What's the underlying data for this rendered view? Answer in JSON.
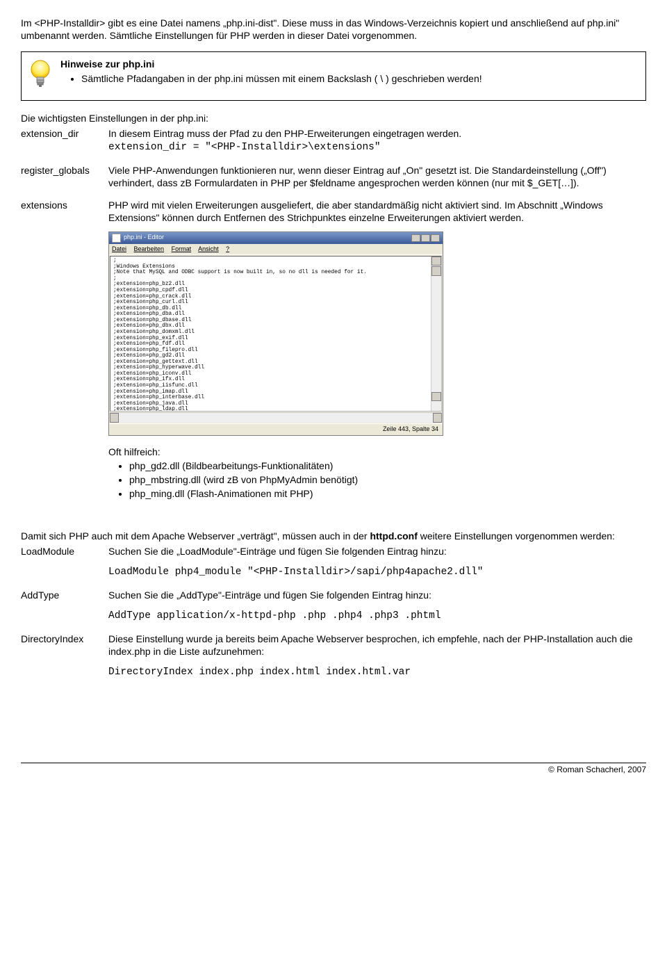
{
  "intro": "Im <PHP-Installdir> gibt es eine Datei namens „php.ini-dist\". Diese muss in das Windows-Verzeichnis kopiert und anschließend auf php.ini\" umbenannt werden. Sämtliche Einstellungen für PHP werden in dieser Datei vorgenommen.",
  "hint": {
    "title": "Hinweise zur php.ini",
    "item": "Sämtliche Pfadangaben in der php.ini müssen mit einem Backslash ( \\ ) geschrieben werden!"
  },
  "phpini_heading": "Die wichtigsten Einstellungen in der php.ini:",
  "phpini": {
    "extension_dir": {
      "key": "extension_dir",
      "text": "In diesem Eintrag muss der Pfad zu den PHP-Erweiterungen eingetragen werden.",
      "code": "extension_dir = \"<PHP-Installdir>\\extensions\""
    },
    "register_globals": {
      "key": "register_globals",
      "text": "Viele PHP-Anwendungen funktionieren nur, wenn dieser Eintrag auf „On\" gesetzt ist. Die Standardeinstellung („Off\") verhindert, dass zB Formulardaten in PHP per $feldname angesprochen werden können (nur mit $_GET[…])."
    },
    "extensions": {
      "key": "extensions",
      "text": "PHP wird mit vielen Erweiterungen ausgeliefert, die aber standardmäßig nicht aktiviert sind. Im Abschnitt „Windows Extensions\" können durch Entfernen des Strichpunktes einzelne Erweiterungen aktiviert werden.",
      "oft_label": "Oft hilfreich:",
      "oft_items": [
        "php_gd2.dll (Bildbearbeitungs-Funktionalitäten)",
        "php_mbstring.dll (wird zB von PhpMyAdmin benötigt)",
        "php_ming.dll (Flash-Animationen mit PHP)"
      ]
    }
  },
  "editor": {
    "title": "php.ini - Editor",
    "menu": {
      "file": "Datei",
      "edit": "Bearbeiten",
      "format": "Format",
      "view": "Ansicht",
      "help": "?"
    },
    "content": ";\n;Windows Extensions\n;Note that MySQL and ODBC support is now built in, so no dll is needed for it.\n;\n;extension=php_bz2.dll\n;extension=php_cpdf.dll\n;extension=php_crack.dll\n;extension=php_curl.dll\n;extension=php_db.dll\n;extension=php_dba.dll\n;extension=php_dbase.dll\n;extension=php_dbx.dll\n;extension=php_domxml.dll\n;extension=php_exif.dll\n;extension=php_fdf.dll\n;extension=php_filepro.dll\n;extension=php_gd2.dll\n;extension=php_gettext.dll\n;extension=php_hyperwave.dll\n;extension=php_iconv.dll\n;extension=php_ifx.dll\n;extension=php_iisfunc.dll\n;extension=php_imap.dll\n;extension=php_interbase.dll\n;extension=php_java.dll\n;extension=php_ldap.dll\n;extension=php_mbstring.dll\n;",
    "status": "Zeile 443, Spalte 34"
  },
  "httpd_intro_pre": "Damit sich PHP auch mit dem Apache Webserver „verträgt\", müssen auch in der ",
  "httpd_intro_bold": "httpd.conf",
  "httpd_intro_post": " weitere Einstellungen vorgenommen werden:",
  "httpd": {
    "loadmodule": {
      "key": "LoadModule",
      "text": "Suchen Sie die „LoadModule\"-Einträge und fügen Sie folgenden Eintrag hinzu:",
      "code": "LoadModule php4_module \"<PHP-Installdir>/sapi/php4apache2.dll\""
    },
    "addtype": {
      "key": "AddType",
      "text": "Suchen Sie die „AddType\"-Einträge und fügen Sie folgenden Eintrag hinzu:",
      "code": "AddType application/x-httpd-php .php .php4 .php3 .phtml"
    },
    "directoryindex": {
      "key": "DirectoryIndex",
      "text": "Diese Einstellung wurde ja bereits beim Apache Webserver besprochen, ich empfehle, nach der PHP-Installation auch die index.php in die Liste aufzunehmen:",
      "code": "DirectoryIndex index.php index.html index.html.var"
    }
  },
  "footer": "© Roman Schacherl, 2007"
}
